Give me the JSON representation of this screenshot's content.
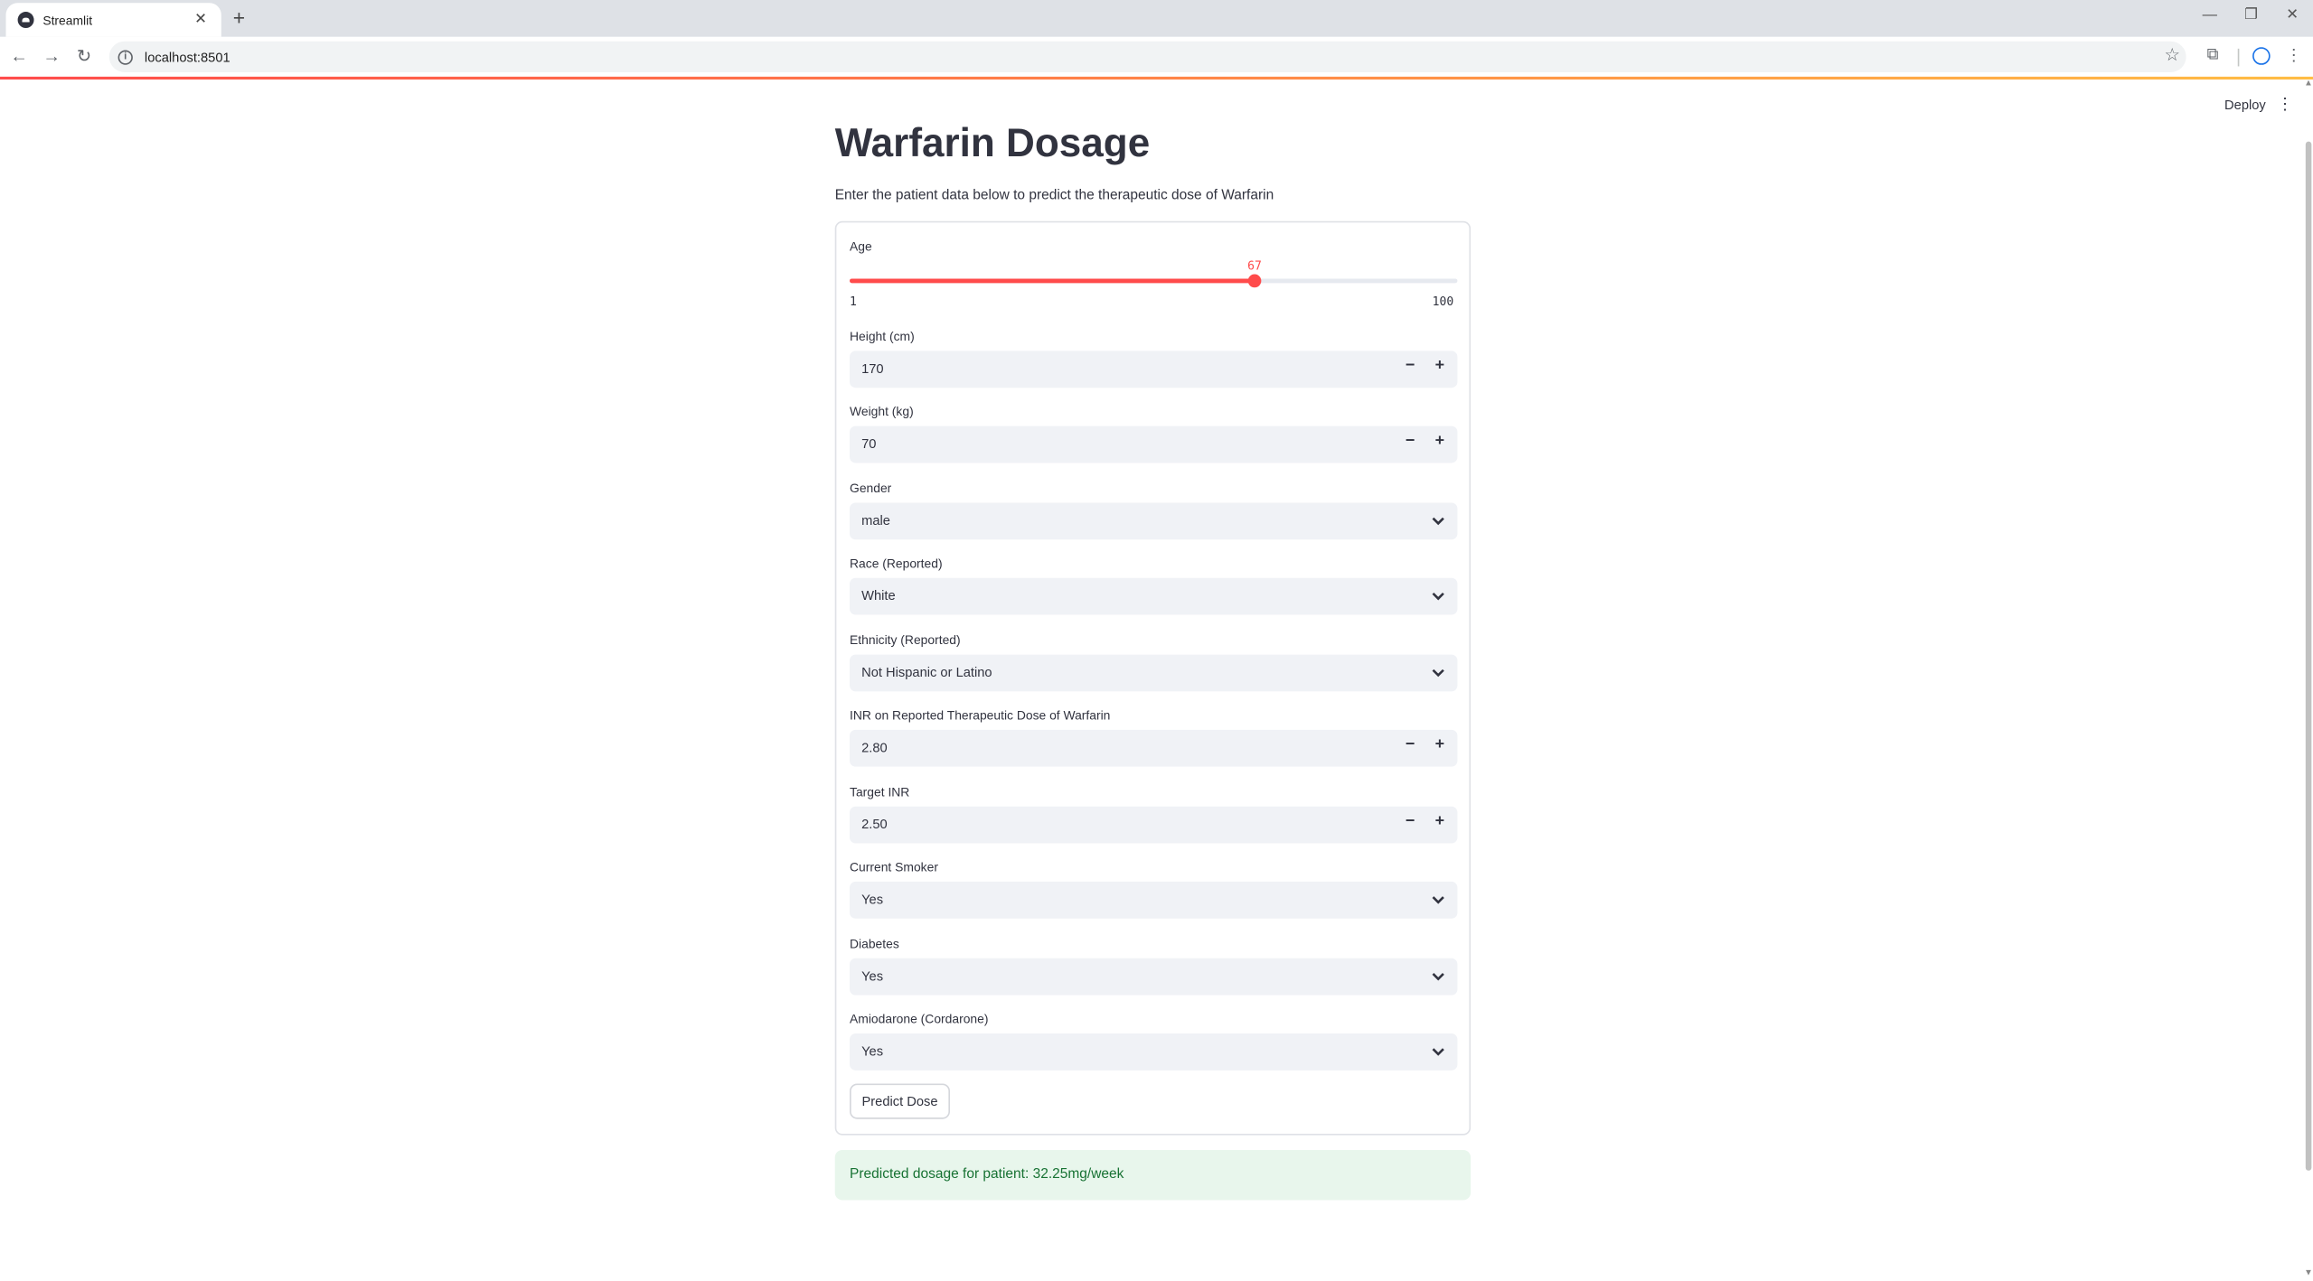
{
  "browser": {
    "tab_title": "Streamlit",
    "tab_close": "✕",
    "new_tab": "+",
    "url": "localhost:8501",
    "window_controls": {
      "minimize": "—",
      "restore": "❐",
      "close": "✕"
    }
  },
  "app": {
    "deploy_label": "Deploy",
    "menu_glyph": "⋮",
    "title": "Warfarin Dosage",
    "description": "Enter the patient data below to predict the therapeutic dose of Warfarin",
    "accent_color": "#ff4b4b",
    "form": {
      "age": {
        "label": "Age",
        "value": 67,
        "value_text": "67",
        "min": 1,
        "max": 100,
        "min_text": "1",
        "max_text": "100"
      },
      "height": {
        "label": "Height (cm)",
        "value": "170"
      },
      "weight": {
        "label": "Weight (kg)",
        "value": "70"
      },
      "gender": {
        "label": "Gender",
        "value": "male"
      },
      "race": {
        "label": "Race (Reported)",
        "value": "White"
      },
      "ethnicity": {
        "label": "Ethnicity (Reported)",
        "value": "Not Hispanic or Latino"
      },
      "inr_reported": {
        "label": "INR on Reported Therapeutic Dose of Warfarin",
        "value": "2.80"
      },
      "target_inr": {
        "label": "Target INR",
        "value": "2.50"
      },
      "smoker": {
        "label": "Current Smoker",
        "value": "Yes"
      },
      "diabetes": {
        "label": "Diabetes",
        "value": "Yes"
      },
      "amiodarone": {
        "label": "Amiodarone (Cordarone)",
        "value": "Yes"
      },
      "stepper": {
        "minus": "−",
        "plus": "+"
      },
      "submit_label": "Predict Dose"
    },
    "result": {
      "text": "Predicted dosage for patient: 32.25mg/week",
      "color": "#177233",
      "background": "#e8f6ec"
    }
  }
}
